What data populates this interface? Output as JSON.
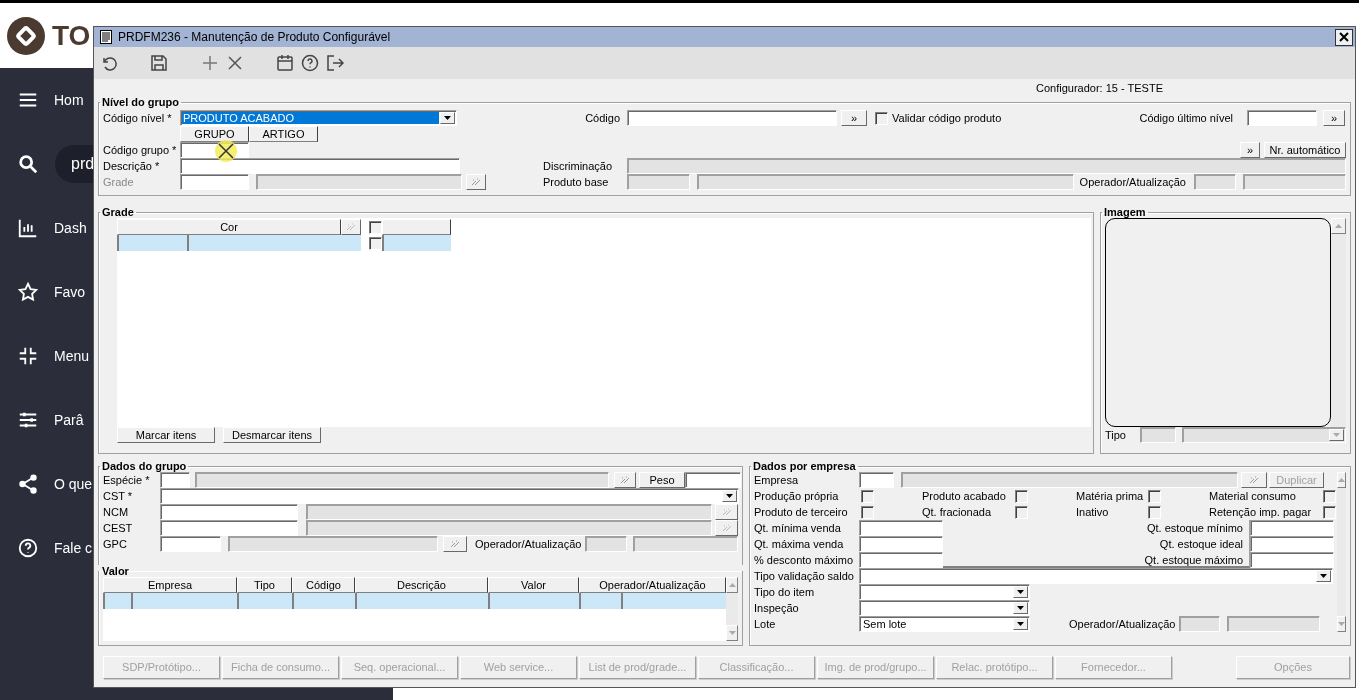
{
  "app": {
    "logo": "TO",
    "nav": [
      {
        "kind": "link",
        "label": "Hom"
      },
      {
        "kind": "search",
        "value": "prd"
      },
      {
        "kind": "link",
        "label": "Dash"
      },
      {
        "kind": "link",
        "label": "Favo"
      },
      {
        "kind": "link",
        "label": "Menu"
      },
      {
        "kind": "link",
        "label": "Parâ"
      },
      {
        "kind": "link",
        "label": "O que"
      },
      {
        "kind": "link",
        "label": "Fale c"
      }
    ]
  },
  "window": {
    "title": "PRDFM236 - Manutenção de Produto Configurável"
  },
  "configurator": "Configurador: 15 - TESTE",
  "group_level": {
    "title": "Nível do grupo",
    "level_label": "Código nível *",
    "level_value": "PRODUTO ACABADO",
    "columns": [
      "GRUPO",
      "ARTIGO"
    ],
    "group_code_label": "Código grupo *",
    "description_label": "Descrição *",
    "grade_label": "Grade",
    "grade_disabled": true,
    "code_label": "Código",
    "code_button": "»",
    "validate": {
      "label": "Validar código produto",
      "checked": false
    },
    "last_level_label": "Código último nível",
    "last_level_button": "»",
    "discrimination_button": "»",
    "auto_number_button": "Nr. automático",
    "discrimination_label": "Discriminação",
    "base_product_label": "Produto base",
    "operator_label": "Operador/Atualização"
  },
  "grade": {
    "title": "Grade",
    "column": "Cor",
    "header_checkbox": {
      "checked": false
    },
    "row_checkbox": {
      "checked": false
    },
    "buttons": [
      "Marcar itens",
      "Desmarcar itens"
    ]
  },
  "image": {
    "title": "Imagem",
    "type_label": "Tipo"
  },
  "group_data": {
    "title": "Dados do grupo",
    "species_label": "Espécie *",
    "weight_label": "Peso",
    "cst_label": "CST *",
    "ncm_label": "NCM",
    "cest_label": "CEST",
    "gpc_label": "GPC",
    "operator_label": "Operador/Atualização"
  },
  "value": {
    "title": "Valor",
    "columns": [
      "Empresa",
      "Tipo",
      "Código",
      "Descrição",
      "Valor",
      "Operador/Atualização"
    ]
  },
  "company_data": {
    "title": "Dados por empresa",
    "company_label": "Empresa",
    "duplicate": {
      "label": "Duplicar",
      "disabled": true
    },
    "flags": [
      {
        "label": "Produção própria",
        "checked": false
      },
      {
        "label": "Produto acabado",
        "checked": false
      },
      {
        "label": "Matéria prima",
        "checked": false
      },
      {
        "label": "Material consumo",
        "checked": false
      },
      {
        "label": "Produto de terceiro",
        "checked": false
      },
      {
        "label": "Qt. fracionada",
        "checked": false
      },
      {
        "label": "Inativo",
        "checked": false
      },
      {
        "label": "Retenção imp. pagar",
        "checked": false
      }
    ],
    "left_quantities": [
      "Qt. mínima venda",
      "Qt. máxima venda",
      "% desconto máximo"
    ],
    "right_quantities": [
      "Qt. estoque mínimo",
      "Qt. estoque ideal",
      "Qt. estoque máximo"
    ],
    "balance_label": "Tipo validação saldo",
    "item_type_label": "Tipo do item",
    "inspection_label": "Inspeção",
    "lot_label": "Lote",
    "lot_value": "Sem lote",
    "operator_label": "Operador/Atualização"
  },
  "actions": [
    {
      "label": "SDP/Protótipo...",
      "disabled": true
    },
    {
      "label": "Ficha de consumo...",
      "disabled": true
    },
    {
      "label": "Seq. operacional...",
      "disabled": true
    },
    {
      "label": "Web service...",
      "disabled": true
    },
    {
      "label": "List de prod/grade...",
      "disabled": true
    },
    {
      "label": "Classificação...",
      "disabled": true
    },
    {
      "label": "Img. de prod/grupo...",
      "disabled": true
    },
    {
      "label": "Relac. protótipo...",
      "disabled": true
    },
    {
      "label": "Fornecedor...",
      "disabled": true
    },
    {
      "label": "Opções",
      "disabled": true
    }
  ]
}
